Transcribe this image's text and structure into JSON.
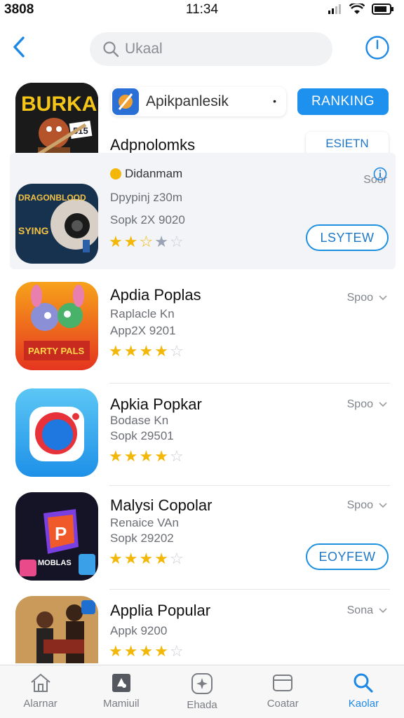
{
  "status_bar": {
    "carrier": "3808",
    "time": "11:34"
  },
  "header": {
    "search_placeholder": "Ukaal"
  },
  "featured": {
    "title": "Adpnolomks",
    "chip_label": "Apikpanlesik",
    "chip_dot": "•",
    "ranking_label": "RANKING",
    "edit_label": "ESIETN"
  },
  "highlighted": {
    "developer": "Didanmam",
    "sub": "Dpypinj z30m",
    "meta": "Sopk 2X 9020",
    "sort": "Soor",
    "button_label": "LSYTEW",
    "rating": 2.5
  },
  "apps": [
    {
      "title": "Apdia Poplas",
      "sub": "Raplacle Kn",
      "meta": "App2X 9201",
      "sort": "Spoo",
      "rating": 4,
      "button_label": ""
    },
    {
      "title": "Apkia Popkar",
      "sub": "Bodase Kn",
      "meta": "Sopk 29501",
      "sort": "Spoo",
      "rating": 4,
      "button_label": ""
    },
    {
      "title": "Malysi Copolar",
      "sub": "Renaice VAn",
      "meta": "Sopk 29202",
      "sort": "Spoo",
      "rating": 4,
      "button_label": "EOYFEW"
    },
    {
      "title": "Applia Popular",
      "sub": "",
      "meta": "Appk 9200",
      "sort": "Sona",
      "rating": 4,
      "button_label": ""
    }
  ],
  "tabs": [
    {
      "label": "Alarnar",
      "icon": "home-icon"
    },
    {
      "label": "Mamiuil",
      "icon": "apps-icon"
    },
    {
      "label": "Ehada",
      "icon": "star-icon"
    },
    {
      "label": "Coatar",
      "icon": "folder-icon"
    },
    {
      "label": "Kaolar",
      "icon": "search-icon",
      "active": true
    }
  ],
  "colors": {
    "accent": "#1e90ee",
    "star": "#f2b707"
  }
}
